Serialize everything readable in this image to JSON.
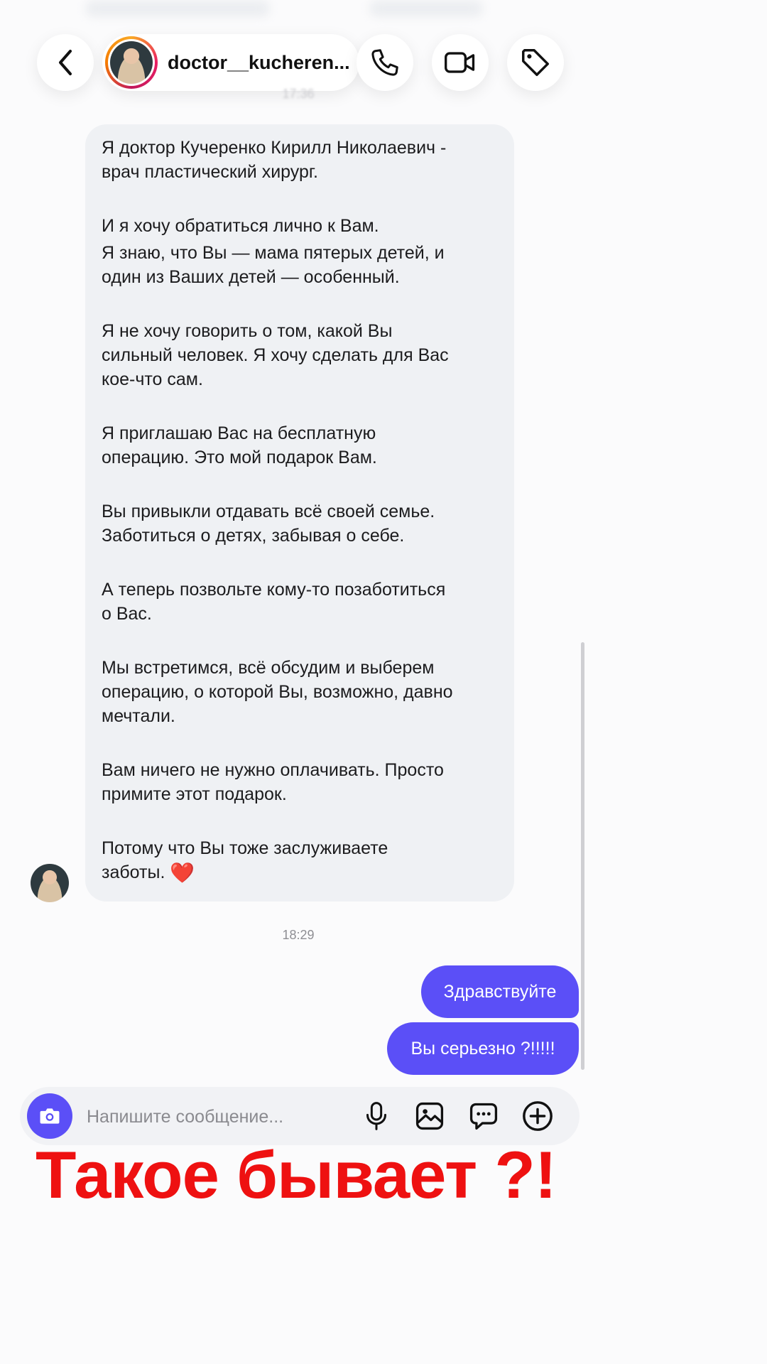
{
  "header": {
    "username": "doctor__kucheren...",
    "top_timestamp": "17:36"
  },
  "message_incoming": {
    "paragraphs": [
      "Я доктор Кучеренко Кирилл Николаевич -\nврач пластический хирург.",
      "И я хочу обратиться лично к Вам.",
      "Я знаю, что Вы — мама пятерых детей, и\nодин из Ваших детей — особенный.",
      "Я не хочу говорить о том, какой Вы\nсильный человек. Я хочу сделать для Вас\nкое-что сам.",
      "Я приглашаю Вас на бесплатную\nоперацию. Это мой подарок Вам.",
      "Вы привыкли отдавать всё своей семье.\nЗаботиться о детях, забывая о себе.",
      "А теперь позвольте кому-то позаботиться\nо Вас.",
      "Мы встретимся, всё обсудим и выберем\nоперацию, о которой Вы, возможно, давно\nмечтали.",
      "Вам ничего не нужно оплачивать. Просто\nпримите этот подарок.",
      "Потому что Вы тоже заслуживаете\nзаботы."
    ],
    "emoji": "❤️"
  },
  "timestamp": "18:29",
  "messages_outgoing": [
    "Здравствуйте",
    "Вы серьезно ?!!!!!"
  ],
  "composer": {
    "placeholder": "Напишите сообщение..."
  },
  "caption": "Такое бывает ?!",
  "colors": {
    "accent": "#5b4ff7",
    "incoming_bubble": "#eff1f4",
    "caption_red": "#ee1111"
  }
}
